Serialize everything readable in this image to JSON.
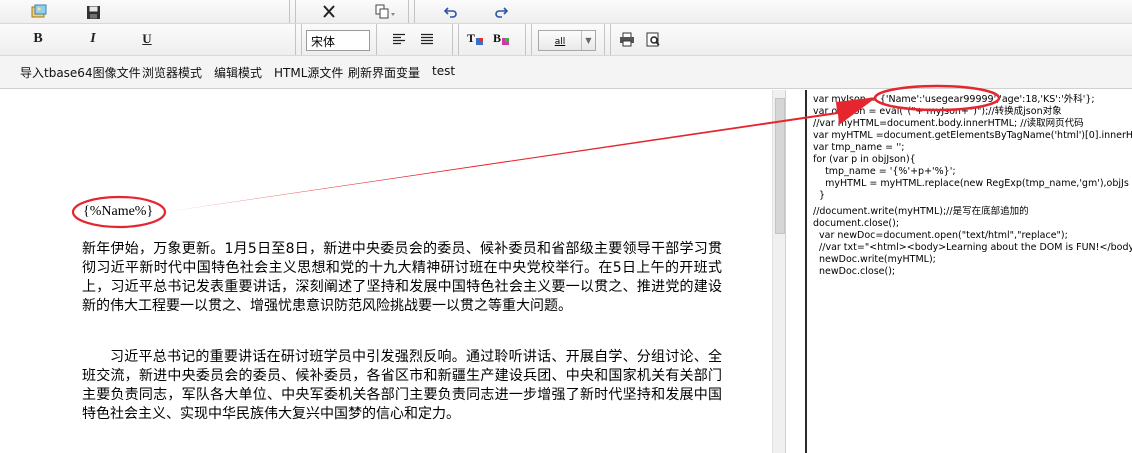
{
  "toolbar": {
    "row1_icons": [
      "open-image-icon",
      "save-icon",
      "cut-icon",
      "paste-icon",
      "undo-icon",
      "redo-icon"
    ],
    "bold_label": "B",
    "italic_label": "I",
    "underline_label": "U",
    "font_name": "宋体",
    "size_value": "all",
    "row2_icons": [
      "align-left-icon",
      "align-justify-icon",
      "text-color-icon",
      "background-color-icon",
      "print-icon",
      "preview-icon"
    ]
  },
  "menu": {
    "items": [
      {
        "label": "导入tbase64图像文件"
      },
      {
        "label": "浏览器模式"
      },
      {
        "label": "编辑模式"
      },
      {
        "label": "HTML源文件"
      },
      {
        "label": "刷新界面变量"
      },
      {
        "label": "test"
      }
    ]
  },
  "editor": {
    "placeholder": "{%Name%}",
    "paragraph1": "新年伊始，万象更新。1月5日至8日，新进中央委员会的委员、候补委员和省部级主要领导干部学习贯彻习近平新时代中国特色社会主义思想和党的十九大精神研讨班在中央党校举行。在5日上午的开班式上，习近平总书记发表重要讲话，深刻阐述了坚持和发展中国特色社会主义要一以贯之、推进党的建设新的伟大工程要一以贯之、增强忧患意识防范风险挑战要一以贯之等重大问题。",
    "paragraph2": "习近平总书记的重要讲话在研讨班学员中引发强烈反响。通过聆听讲话、开展自学、分组讨论、全班交流，新进中央委员会的委员、候补委员，各省区市和新疆生产建设兵团、中央和国家机关有关部门主要负责同志，军队各大单位、中央军委机关各部门主要负责同志进一步增强了新时代坚持和发展中国特色社会主义、实现中华民族伟大复兴中国梦的信心和定力。"
  },
  "code": {
    "lines": [
      "var myJson = {'Name':'usegear99999','age':18,'KS':'外科'};",
      "var objJson = eval(\"(\"+ myJson+\")\");//转换成json对象",
      "//var myHTML=document.body.innerHTML; //读取网页代码",
      "var myHTML =document.getElementsByTagName('html')[0].innerHTML",
      "var tmp_name = '';",
      "for (var p in objJson){",
      "    tmp_name = '{%'+p+'%}';",
      "    myHTML = myHTML.replace(new RegExp(tmp_name,'gm'),objJs",
      "  }",
      "//document.write(myHTML);//是写在底部追加的",
      "document.close();",
      "  var newDoc=document.open(\"text/html\",\"replace\");",
      "  //var txt=\"<html><body>Learning about the DOM is FUN!</body",
      "  newDoc.write(myHTML);",
      "  newDoc.close();"
    ]
  },
  "colors": {
    "annotation": "#e5262f",
    "pane_border": "#2a2a2a"
  }
}
